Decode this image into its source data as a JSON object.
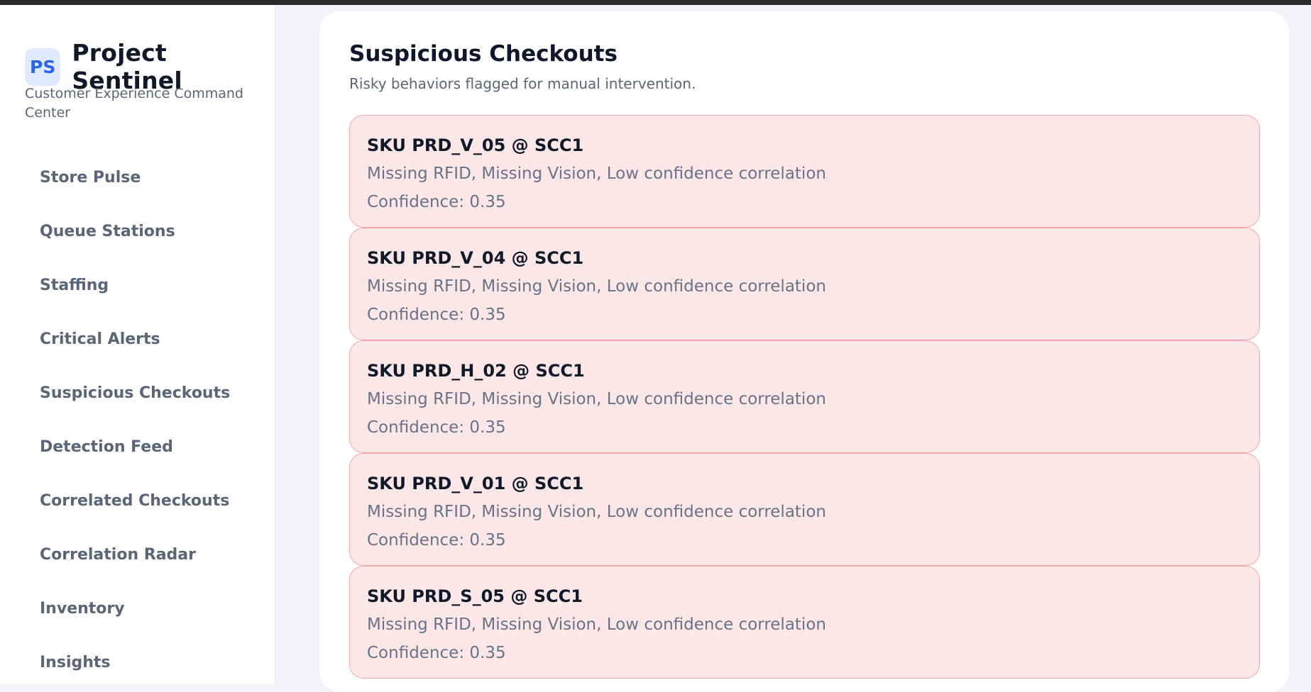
{
  "app": {
    "badge": "PS",
    "title": "Project Sentinel",
    "subtitle": "Customer Experience Command Center"
  },
  "sidebar": {
    "items": [
      {
        "label": "Store Pulse"
      },
      {
        "label": "Queue Stations"
      },
      {
        "label": "Staffing"
      },
      {
        "label": "Critical Alerts"
      },
      {
        "label": "Suspicious Checkouts"
      },
      {
        "label": "Detection Feed"
      },
      {
        "label": "Correlated Checkouts"
      },
      {
        "label": "Correlation Radar"
      },
      {
        "label": "Inventory"
      },
      {
        "label": "Insights"
      }
    ]
  },
  "main": {
    "title": "Suspicious Checkouts",
    "subtitle": "Risky behaviors flagged for manual intervention.",
    "alerts": [
      {
        "title": "SKU PRD_V_05 @ SCC1",
        "reasons": "Missing RFID, Missing Vision, Low confidence correlation",
        "confidence": "Confidence: 0.35"
      },
      {
        "title": "SKU PRD_V_04 @ SCC1",
        "reasons": "Missing RFID, Missing Vision, Low confidence correlation",
        "confidence": "Confidence: 0.35"
      },
      {
        "title": "SKU PRD_H_02 @ SCC1",
        "reasons": "Missing RFID, Missing Vision, Low confidence correlation",
        "confidence": "Confidence: 0.35"
      },
      {
        "title": "SKU PRD_V_01 @ SCC1",
        "reasons": "Missing RFID, Missing Vision, Low confidence correlation",
        "confidence": "Confidence: 0.35"
      },
      {
        "title": "SKU PRD_S_05 @ SCC1",
        "reasons": "Missing RFID, Missing Vision, Low confidence correlation",
        "confidence": "Confidence: 0.35"
      }
    ]
  },
  "colors": {
    "accent": "#2a63e6",
    "alert_bg": "#fbe7e8",
    "alert_border": "#f0a9ad"
  }
}
